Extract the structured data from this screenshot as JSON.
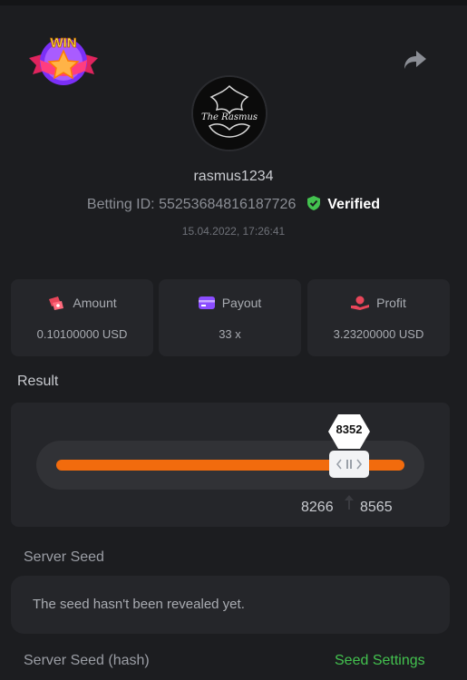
{
  "profile": {
    "username": "rasmus1234",
    "betting_id_label": "Betting ID: 55253684816187726",
    "verified_label": "Verified",
    "timestamp": "15.04.2022, 17:26:41",
    "badge_text": "WIN",
    "avatar_text": "The Rasmus"
  },
  "stats": [
    {
      "label": "Amount",
      "value": "0.10100000 USD",
      "icon": "money-icon"
    },
    {
      "label": "Payout",
      "value": "33 x",
      "icon": "card-icon"
    },
    {
      "label": "Profit",
      "value": "3.23200000 USD",
      "icon": "profit-hand-icon"
    }
  ],
  "result": {
    "title": "Result",
    "value": "8352",
    "range_min": "8266",
    "range_max": "8565"
  },
  "server_seed": {
    "label": "Server Seed",
    "text": "The seed hasn't been revealed yet."
  },
  "server_seed_hash": {
    "label": "Server Seed (hash)",
    "settings_link": "Seed Settings"
  },
  "colors": {
    "background": "#1c1d20",
    "card": "#25262a",
    "accent_orange": "#f26b0d",
    "verified_green": "#43c24f",
    "link_green": "#43c24f"
  }
}
